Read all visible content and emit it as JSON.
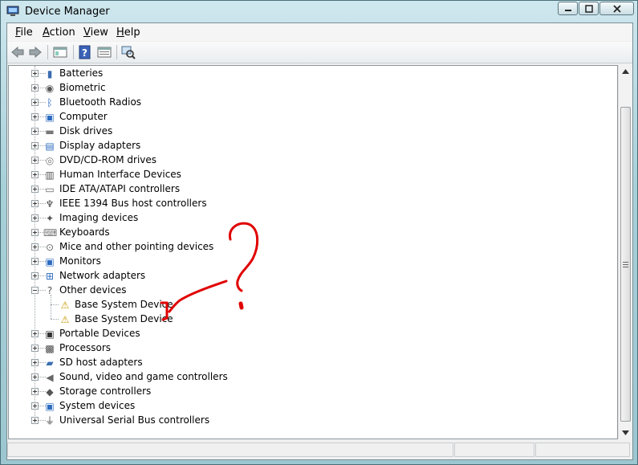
{
  "window": {
    "title": "Device Manager"
  },
  "menu": [
    {
      "label": "File",
      "access": "F",
      "rest": "ile"
    },
    {
      "label": "Action",
      "access": "A",
      "rest": "ction"
    },
    {
      "label": "View",
      "access": "V",
      "rest": "iew"
    },
    {
      "label": "Help",
      "access": "H",
      "rest": "elp"
    }
  ],
  "toolbar": {
    "icons": [
      "back-arrow-icon",
      "forward-arrow-icon",
      "show-hide-console-tree-icon",
      "help-icon",
      "properties-icon",
      "scan-hardware-changes-icon"
    ]
  },
  "tree": {
    "categories": [
      {
        "label": "Batteries",
        "icon": "battery-icon",
        "expanded": false
      },
      {
        "label": "Biometric",
        "icon": "biometric-icon",
        "expanded": false
      },
      {
        "label": "Bluetooth Radios",
        "icon": "bluetooth-icon",
        "expanded": false
      },
      {
        "label": "Computer",
        "icon": "computer-icon",
        "expanded": false
      },
      {
        "label": "Disk drives",
        "icon": "disk-drive-icon",
        "expanded": false
      },
      {
        "label": "Display adapters",
        "icon": "display-adapter-icon",
        "expanded": false
      },
      {
        "label": "DVD/CD-ROM drives",
        "icon": "dvd-drive-icon",
        "expanded": false
      },
      {
        "label": "Human Interface Devices",
        "icon": "hid-icon",
        "expanded": false
      },
      {
        "label": "IDE ATA/ATAPI controllers",
        "icon": "ide-controller-icon",
        "expanded": false
      },
      {
        "label": "IEEE 1394 Bus host controllers",
        "icon": "ieee1394-icon",
        "expanded": false
      },
      {
        "label": "Imaging devices",
        "icon": "camera-icon",
        "expanded": false
      },
      {
        "label": "Keyboards",
        "icon": "keyboard-icon",
        "expanded": false
      },
      {
        "label": "Mice and other pointing devices",
        "icon": "mouse-icon",
        "expanded": false
      },
      {
        "label": "Monitors",
        "icon": "monitor-icon",
        "expanded": false
      },
      {
        "label": "Network adapters",
        "icon": "network-adapter-icon",
        "expanded": false
      },
      {
        "label": "Other devices",
        "icon": "unknown-device-icon",
        "expanded": true,
        "children": [
          {
            "label": "Base System Device",
            "icon": "warning-device-icon"
          },
          {
            "label": "Base System Device",
            "icon": "warning-device-icon"
          }
        ]
      },
      {
        "label": "Portable Devices",
        "icon": "portable-device-icon",
        "expanded": false
      },
      {
        "label": "Processors",
        "icon": "processor-icon",
        "expanded": false
      },
      {
        "label": "SD host adapters",
        "icon": "sd-card-icon",
        "expanded": false
      },
      {
        "label": "Sound, video and game controllers",
        "icon": "speaker-icon",
        "expanded": false
      },
      {
        "label": "Storage controllers",
        "icon": "storage-controller-icon",
        "expanded": false
      },
      {
        "label": "System devices",
        "icon": "system-device-icon",
        "expanded": false
      },
      {
        "label": "Universal Serial Bus controllers",
        "icon": "usb-icon",
        "expanded": false
      }
    ]
  },
  "annotation": {
    "color": "#e00000",
    "shape": "question-mark-with-arrow-and-bracket"
  }
}
